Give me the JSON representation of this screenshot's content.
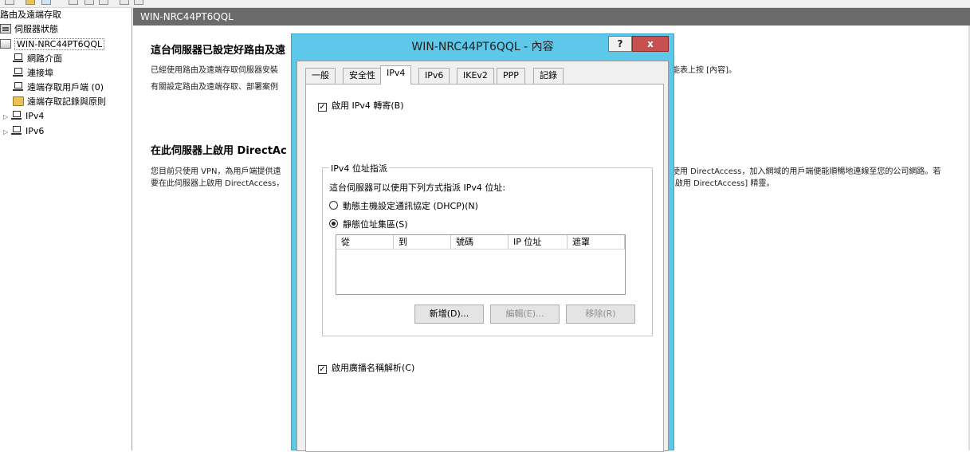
{
  "tree": {
    "root_label": "路由及遠端存取",
    "items": [
      {
        "label": "伺服器狀態"
      },
      {
        "label": "WIN-NRC44PT6QQL"
      },
      {
        "label": "網路介面"
      },
      {
        "label": "連接埠"
      },
      {
        "label": "遠端存取用戶端 (0)"
      },
      {
        "label": "遠端存取記錄與原則"
      },
      {
        "label": "IPv4"
      },
      {
        "label": "IPv6"
      }
    ]
  },
  "right_pane": {
    "header": "WIN-NRC44PT6QQL",
    "title1": "這台伺服器已設定好路由及遠",
    "text1": "已經使用路由及遠端存取伺服器安裝",
    "text1_right": "能表上按 [內容]。",
    "text2": "有關設定路由及遠端存取、部署案例",
    "title2": "在此伺服器上啟用 DirectAc",
    "text3": "您目前只使用 VPN，為用戶端提供遠",
    "text3_right": "使用 DirectAccess，加入網域的用戶端便能順暢地連線至您的公司網路。若",
    "text4": "要在此伺服器上啟用 DirectAccess，",
    "text4_right": "[啟用 DirectAccess] 精靈。"
  },
  "dialog": {
    "title": "WIN-NRC44PT6QQL - 內容",
    "help_label": "?",
    "close_label": "x",
    "tabs": [
      "一般",
      "安全性",
      "IPv4",
      "IPv6",
      "IKEv2",
      "PPP",
      "記錄"
    ],
    "enable_ipv4_forwarding": "啟用 IPv4 轉寄(B)",
    "group_label": "IPv4 位址指派",
    "group_desc": "這台伺服器可以使用下列方式指派 IPv4 位址:",
    "radio_dhcp": "動態主機設定通訊協定 (DHCP)(N)",
    "radio_static": "靜態位址集區(S)",
    "table_columns": [
      "從",
      "到",
      "號碼",
      "IP 位址",
      "遮罩"
    ],
    "btn_add": "新增(D)...",
    "btn_edit": "編輯(E)...",
    "btn_remove": "移除(R)",
    "enable_broadcast": "啟用廣播名稱解析(C)",
    "check_mark": "✓"
  }
}
